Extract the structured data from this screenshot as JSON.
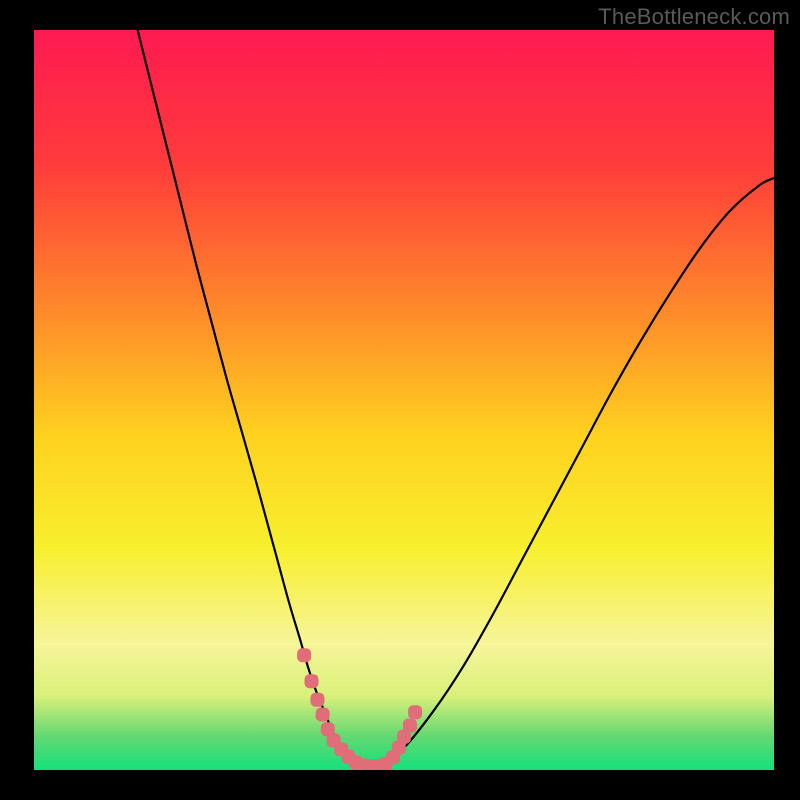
{
  "watermark": "TheBottleneck.com",
  "chart_data": {
    "type": "line",
    "title": "",
    "xlabel": "",
    "ylabel": "",
    "xlim": [
      0,
      100
    ],
    "ylim": [
      0,
      100
    ],
    "legend": false,
    "grid": false,
    "background_gradient": {
      "stops": [
        {
          "pos": 0.0,
          "color": "#ff1a52"
        },
        {
          "pos": 0.18,
          "color": "#ff3b3b"
        },
        {
          "pos": 0.38,
          "color": "#ff8a2a"
        },
        {
          "pos": 0.55,
          "color": "#ffd21f"
        },
        {
          "pos": 0.7,
          "color": "#f8ef2e"
        },
        {
          "pos": 0.83,
          "color": "#f6f59a"
        },
        {
          "pos": 0.9,
          "color": "#d9f07a"
        },
        {
          "pos": 0.955,
          "color": "#62d872"
        },
        {
          "pos": 1.0,
          "color": "#15e07c"
        }
      ]
    },
    "series": [
      {
        "name": "bottleneck-curve",
        "color": "#000000",
        "x": [
          14.0,
          16.0,
          18.0,
          20.0,
          22.0,
          24.0,
          26.0,
          28.0,
          30.0,
          31.5,
          33.0,
          34.5,
          36.0,
          37.0,
          38.0,
          39.0,
          40.0,
          41.0,
          42.0,
          43.5,
          45.0,
          47.0,
          50.0,
          54.0,
          58.0,
          62.0,
          66.0,
          70.0,
          74.0,
          78.0,
          82.0,
          86.0,
          90.0,
          94.0,
          98.0,
          100.0
        ],
        "y": [
          100.0,
          92.0,
          84.0,
          76.0,
          68.0,
          60.5,
          53.0,
          46.0,
          39.0,
          33.5,
          28.0,
          22.5,
          17.5,
          14.0,
          11.0,
          8.5,
          6.0,
          4.0,
          2.5,
          1.0,
          0.5,
          0.5,
          3.0,
          8.0,
          14.0,
          21.0,
          28.5,
          36.0,
          43.5,
          51.0,
          58.0,
          64.5,
          70.5,
          75.5,
          79.0,
          80.0
        ]
      },
      {
        "name": "highlight-zone",
        "color": "#e06d78",
        "style": "thick-dotted",
        "x": [
          36.5,
          37.5,
          38.3,
          39.0,
          39.7,
          40.5,
          41.5,
          42.5,
          43.5,
          44.5,
          45.5,
          46.5,
          47.5,
          48.5,
          49.3,
          50.0,
          50.8,
          51.5
        ],
        "y": [
          15.5,
          12.0,
          9.5,
          7.5,
          5.5,
          4.0,
          2.8,
          1.8,
          1.0,
          0.6,
          0.5,
          0.5,
          0.8,
          1.7,
          3.0,
          4.5,
          6.0,
          7.8
        ]
      }
    ],
    "annotations": []
  }
}
